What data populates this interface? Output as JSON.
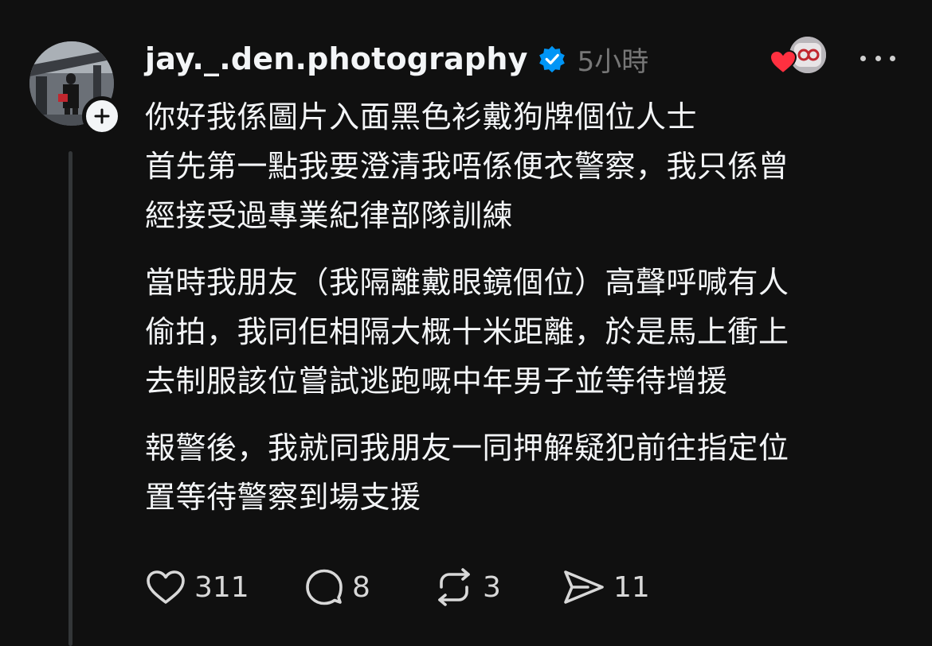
{
  "post": {
    "username": "jay._.den.photography",
    "verified": true,
    "time": "5小時",
    "accent_color": "#0095f6",
    "paragraphs": [
      {
        "lines": [
          "你好我係圖片入面黑色衫戴狗牌個位人士",
          "首先第一點我要澄清我唔係便衣警察，我只係曾",
          "經接受過專業紀律部隊訓練"
        ]
      },
      {
        "lines": [
          "當時我朋友（我隔離戴眼鏡個位）高聲呼喊有人",
          "偷拍，我同佢相隔大概十米距離，於是馬上衝上",
          "去制服該位嘗試逃跑嘅中年男子並等待增援"
        ]
      },
      {
        "lines": [
          "報警後，我就同我朋友一同押解疑犯前往指定位",
          "置等待警察到場支援"
        ]
      }
    ],
    "actions": {
      "likes": "311",
      "replies": "8",
      "reposts": "3",
      "shares": "11"
    },
    "icons": {
      "avatar": "avatar",
      "follow": "plus-icon",
      "verified": "verified-badge-icon",
      "reaction": "heart-icon",
      "more": "more-horizontal-icon",
      "like": "heart-outline-icon",
      "reply": "comment-icon",
      "repost": "repost-icon",
      "share": "send-icon"
    }
  }
}
